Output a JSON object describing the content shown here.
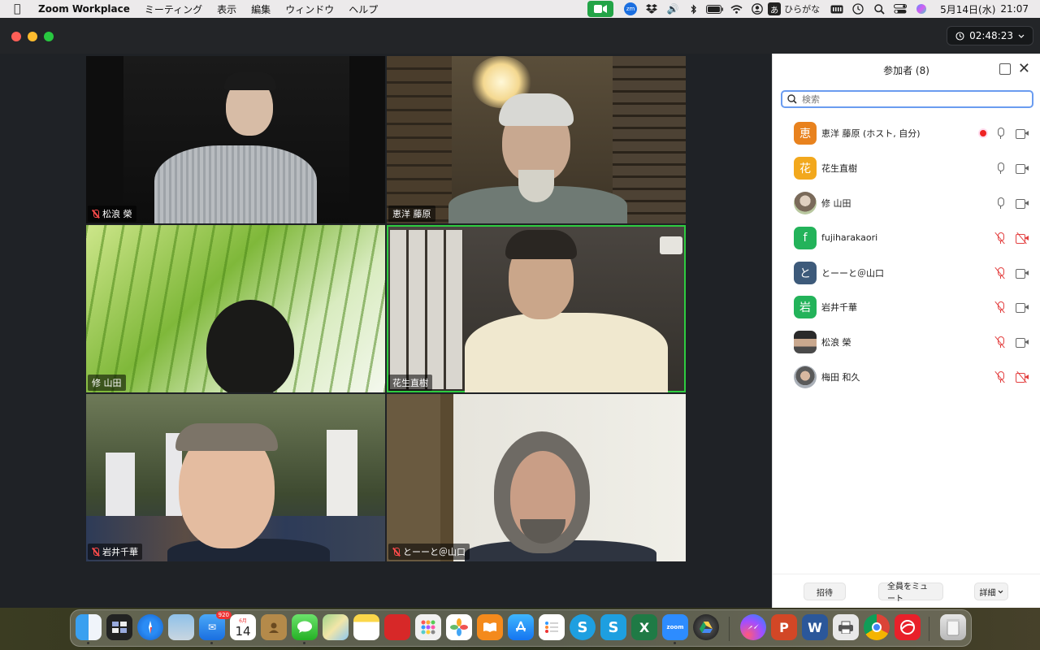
{
  "menubar": {
    "app_name": "Zoom Workplace",
    "menus": [
      "ミーティング",
      "表示",
      "編集",
      "ウィンドウ",
      "ヘルプ"
    ],
    "input_mode_badge": "あ",
    "input_mode_label": "ひらがな",
    "date": "5月14日(水)",
    "time": "21:07",
    "zoom_tray_label": "zm"
  },
  "window": {
    "meeting_timer": "02:48:23"
  },
  "tiles": [
    {
      "name": "松浪 榮",
      "muted": true
    },
    {
      "name": "恵洋 藤原",
      "muted": false
    },
    {
      "name": "修 山田",
      "muted": false
    },
    {
      "name": "花生直樹",
      "muted": false,
      "active_speaker": true
    },
    {
      "name": "岩井千華",
      "muted": true
    },
    {
      "name": "とーーと＠山口",
      "muted": true
    }
  ],
  "panel": {
    "title": "参加者 (8)",
    "search_placeholder": "検索",
    "participants": [
      {
        "avatar": "恵",
        "avatar_color": "#e8821e",
        "name": "恵洋 藤原 (ホスト, 自分)",
        "recording": true,
        "mic_muted": false,
        "video_off": false
      },
      {
        "avatar": "花",
        "avatar_color": "#f2a81d",
        "name": "花生直樹",
        "mic_muted": false,
        "video_off": false
      },
      {
        "avatar": "",
        "avatar_color": "#9b8e7e",
        "name": "修 山田",
        "mic_muted": false,
        "video_off": false
      },
      {
        "avatar": "f",
        "avatar_color": "#23b35a",
        "name": "fujiharakaori",
        "mic_muted": true,
        "video_off": true
      },
      {
        "avatar": "と",
        "avatar_color": "#3d5a7a",
        "name": "とーーと＠山口",
        "mic_muted": true,
        "video_off": false
      },
      {
        "avatar": "岩",
        "avatar_color": "#23b35a",
        "name": "岩井千華",
        "mic_muted": true,
        "video_off": false
      },
      {
        "avatar": "",
        "avatar_color": "#5a4a3a",
        "name": "松浪 榮",
        "mic_muted": true,
        "video_off": false
      },
      {
        "avatar": "",
        "avatar_color": "#8a9098",
        "name": "梅田 和久",
        "mic_muted": true,
        "video_off": true
      }
    ],
    "footer": {
      "invite": "招待",
      "mute_all": "全員をミュート",
      "more": "詳細"
    }
  },
  "dock": {
    "mail_badge": "920",
    "calendar_month": "6月",
    "calendar_day": "14",
    "zoom_label": "zoom"
  }
}
